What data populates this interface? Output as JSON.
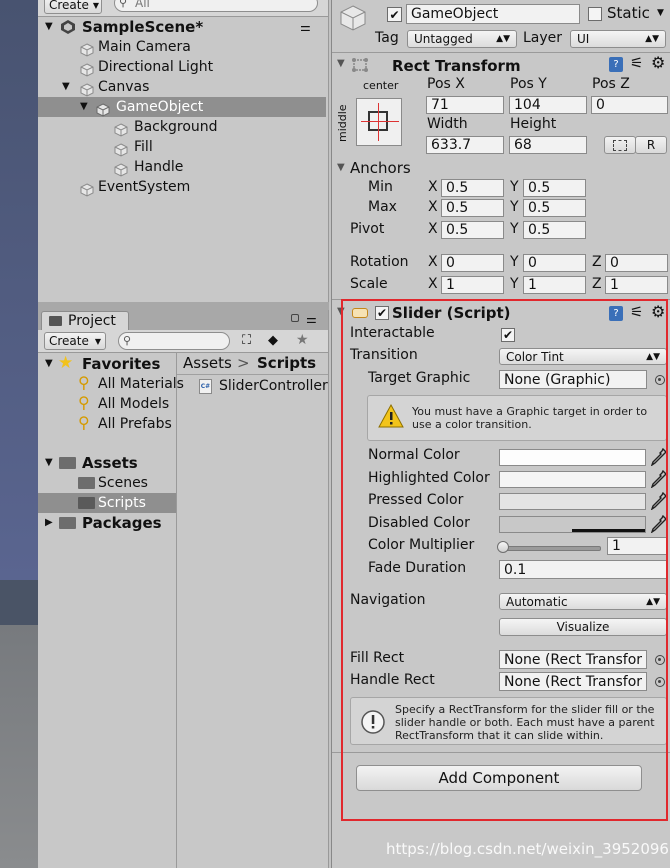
{
  "hierarchy": {
    "create_label": "Create",
    "search_placeholder": "All",
    "scene_name": "SampleScene*",
    "items": [
      {
        "label": "Main Camera"
      },
      {
        "label": "Directional Light"
      },
      {
        "label": "Canvas"
      },
      {
        "label": "GameObject"
      },
      {
        "label": "Background"
      },
      {
        "label": "Fill"
      },
      {
        "label": "Handle"
      },
      {
        "label": "EventSystem"
      }
    ]
  },
  "project": {
    "tab_label": "Project",
    "create_label": "Create",
    "favorites_label": "Favorites",
    "favorites": [
      "All Materials",
      "All Models",
      "All Prefabs"
    ],
    "assets_label": "Assets",
    "asset_folders": [
      "Scenes",
      "Scripts"
    ],
    "packages_label": "Packages",
    "breadcrumb_root": "Assets",
    "breadcrumb_sep": ">",
    "breadcrumb_current": "Scripts",
    "files": [
      {
        "label": "SliderController",
        "badge": "C#"
      }
    ]
  },
  "inspector": {
    "object_name": "GameObject",
    "static_label": "Static",
    "tag_label": "Tag",
    "tag_value": "Untagged",
    "layer_label": "Layer",
    "layer_value": "UI",
    "rect_transform": {
      "title": "Rect Transform",
      "anchor_h": "center",
      "anchor_v": "middle",
      "pos_x_label": "Pos X",
      "pos_y_label": "Pos Y",
      "pos_z_label": "Pos Z",
      "pos_x": "71",
      "pos_y": "104",
      "pos_z": "0",
      "width_label": "Width",
      "height_label": "Height",
      "width": "633.7",
      "height": "68",
      "r_button": "R",
      "anchors_label": "Anchors",
      "min_label": "Min",
      "max_label": "Max",
      "pivot_label": "Pivot",
      "x_label": "X",
      "y_label": "Y",
      "z_label": "Z",
      "min_x": "0.5",
      "min_y": "0.5",
      "max_x": "0.5",
      "max_y": "0.5",
      "pivot_x": "0.5",
      "pivot_y": "0.5",
      "rotation_label": "Rotation",
      "rot_x": "0",
      "rot_y": "0",
      "rot_z": "0",
      "scale_label": "Scale",
      "scale_x": "1",
      "scale_y": "1",
      "scale_z": "1"
    },
    "slider": {
      "title": "Slider (Script)",
      "interactable_label": "Interactable",
      "transition_label": "Transition",
      "transition_value": "Color Tint",
      "target_graphic_label": "Target Graphic",
      "target_graphic_value": "None (Graphic)",
      "warning_text": "You must have a Graphic target in order to use a color transition.",
      "normal_color_label": "Normal Color",
      "highlighted_color_label": "Highlighted Color",
      "pressed_color_label": "Pressed Color",
      "disabled_color_label": "Disabled Color",
      "color_multiplier_label": "Color Multiplier",
      "color_multiplier_value": "1",
      "fade_duration_label": "Fade Duration",
      "fade_duration_value": "0.1",
      "navigation_label": "Navigation",
      "navigation_value": "Automatic",
      "visualize_label": "Visualize",
      "fill_rect_label": "Fill Rect",
      "fill_rect_value": "None (Rect Transfor",
      "handle_rect_label": "Handle Rect",
      "handle_rect_value": "None (Rect Transfor",
      "info_text": "Specify a RectTransform for the slider fill or the slider handle or both. Each must have a parent RectTransform that it can slide within."
    },
    "add_component_label": "Add Component"
  },
  "colors": {
    "selection_blue": "#3d75c9",
    "highlight_red": "#e1282d",
    "panel_gray": "#c8c8c8"
  },
  "watermark": "https://blog.csdn.net/weixin_39520967"
}
